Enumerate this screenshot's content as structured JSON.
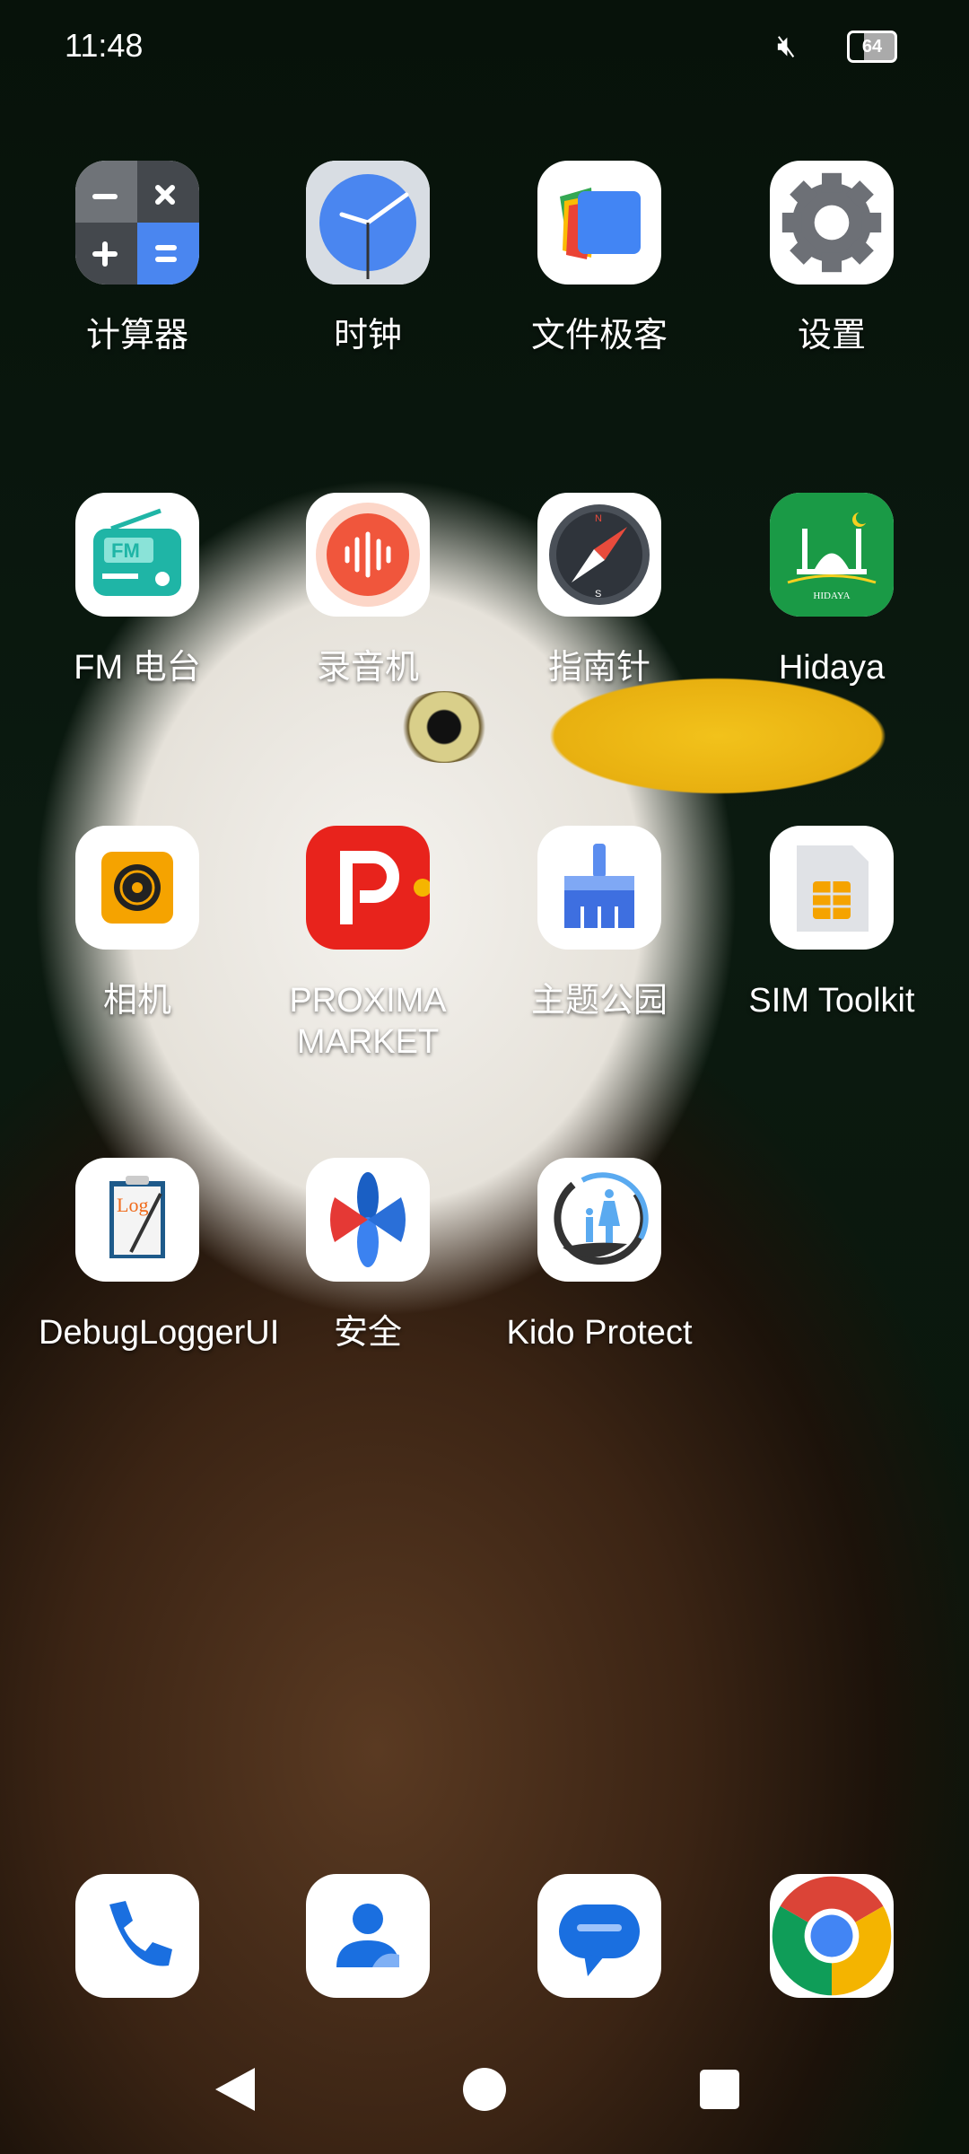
{
  "status_bar": {
    "time": "11:48",
    "battery": "64",
    "mute_icon": "mute-icon"
  },
  "apps": [
    {
      "label": "计算器",
      "icon": "calculator-icon"
    },
    {
      "label": "时钟",
      "icon": "clock-icon"
    },
    {
      "label": "文件极客",
      "icon": "files-icon"
    },
    {
      "label": "设置",
      "icon": "gear-icon"
    },
    {
      "label": "FM 电台",
      "icon": "radio-icon"
    },
    {
      "label": "录音机",
      "icon": "recorder-icon"
    },
    {
      "label": "指南针",
      "icon": "compass-icon"
    },
    {
      "label": "Hidaya",
      "icon": "mosque-icon",
      "badge_text": "HIDAYA"
    },
    {
      "label": "相机",
      "icon": "camera-icon"
    },
    {
      "label": "PROXIMA MARKET",
      "icon": "proxima-icon"
    },
    {
      "label": "主题公园",
      "icon": "theme-brush-icon"
    },
    {
      "label": "SIM Toolkit",
      "icon": "sim-card-icon"
    },
    {
      "label": "DebugLoggerUI",
      "icon": "log-clipboard-icon",
      "icon_text": "Log"
    },
    {
      "label": "安全",
      "icon": "safety-icon"
    },
    {
      "label": "Kido Protect",
      "icon": "family-hand-icon"
    }
  ],
  "dock": [
    {
      "name": "phone",
      "icon": "phone-icon"
    },
    {
      "name": "contacts",
      "icon": "contacts-icon"
    },
    {
      "name": "messages",
      "icon": "messages-icon"
    },
    {
      "name": "chrome",
      "icon": "chrome-icon"
    }
  ],
  "nav": {
    "back": "back-icon",
    "home": "home-icon",
    "recents": "recents-icon"
  }
}
